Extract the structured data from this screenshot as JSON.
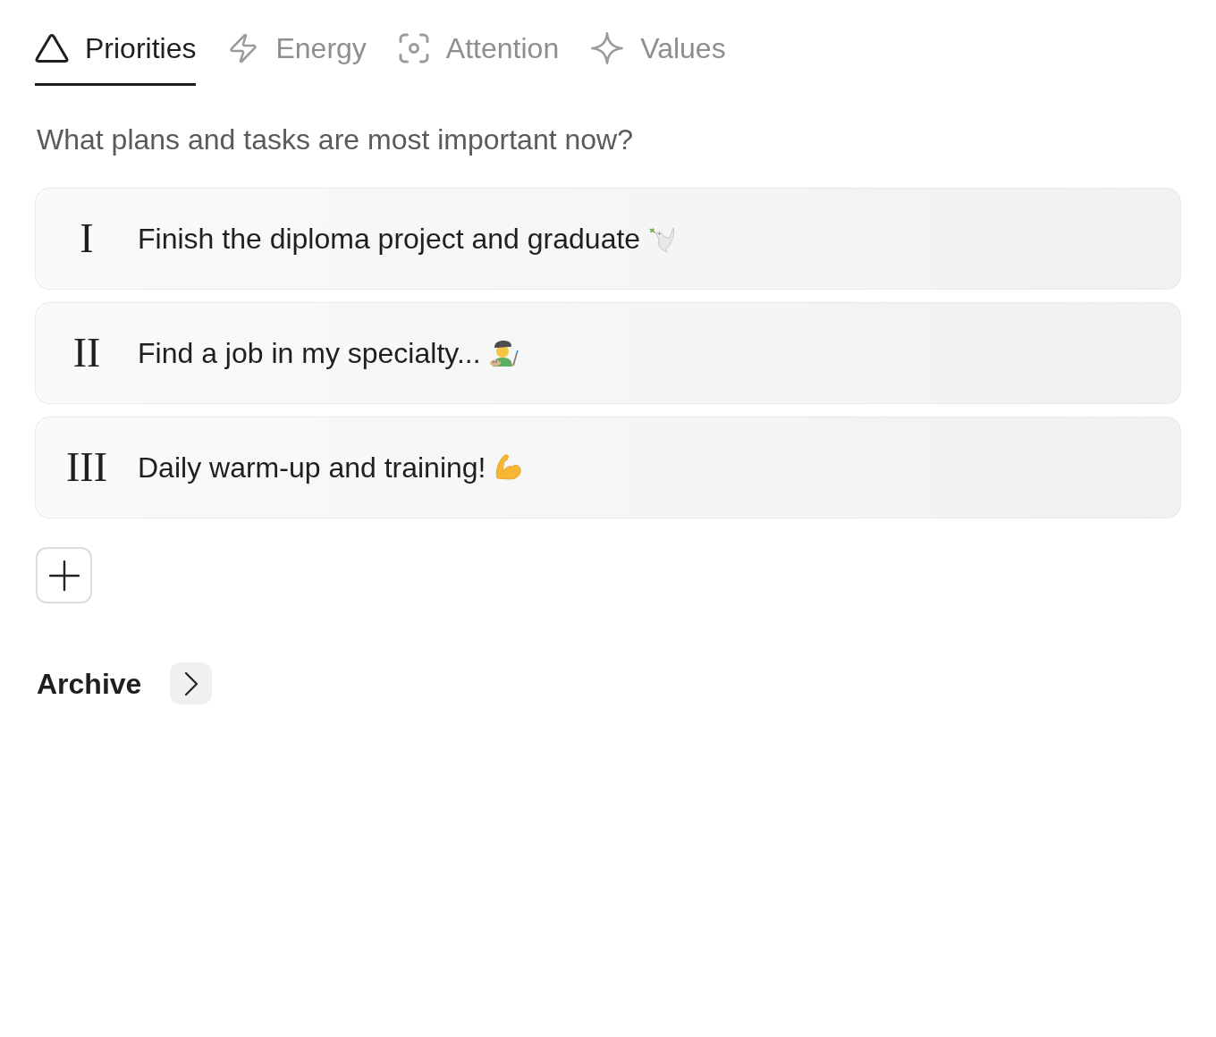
{
  "tabs": [
    {
      "label": "Priorities",
      "selected": true
    },
    {
      "label": "Energy",
      "selected": false
    },
    {
      "label": "Attention",
      "selected": false
    },
    {
      "label": "Values",
      "selected": false
    }
  ],
  "prompt": "What plans and tasks are most important now?",
  "priorities": [
    {
      "numeral": "I",
      "text": "Finish the diploma project and graduate"
    },
    {
      "numeral": "II",
      "text": "Find a job in my specialty..."
    },
    {
      "numeral": "III",
      "text": "Daily warm-up and training!"
    }
  ],
  "archive": {
    "label": "Archive"
  }
}
